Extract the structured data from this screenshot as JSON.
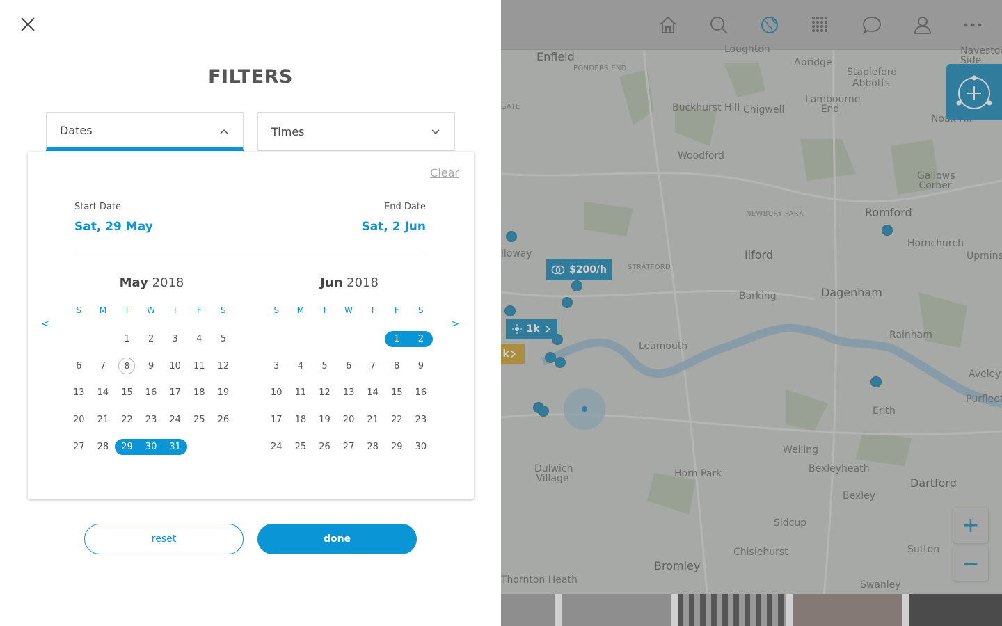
{
  "filters": {
    "title": "FILTERS",
    "dates_label": "Dates",
    "times_label": "Times",
    "clear_label": "Clear",
    "start_date_label": "Start Date",
    "start_date_value": "Sat, 29 May",
    "end_date_label": "End Date",
    "end_date_value": "Sat, 2 Jun",
    "prev_arrow": "<",
    "next_arrow": ">",
    "reset_label": "reset",
    "done_label": "done"
  },
  "calendar": {
    "weekdays": [
      "S",
      "M",
      "T",
      "W",
      "T",
      "F",
      "S"
    ],
    "months": [
      {
        "name": "May",
        "year": "2018",
        "offset": 2,
        "days": 31,
        "today": 8,
        "selected": [
          29,
          30,
          31
        ]
      },
      {
        "name": "Jun",
        "year": "2018",
        "offset": 5,
        "days": 30,
        "today": null,
        "selected": [
          1,
          2
        ]
      }
    ]
  },
  "map": {
    "price_tag": "$200/h",
    "count_tag": "1k",
    "count_tag2": "k",
    "zoom_in": "+",
    "zoom_out": "−",
    "places": [
      {
        "name": "Enfield"
      },
      {
        "name": "PONDERS END"
      },
      {
        "name": "Loughton"
      },
      {
        "name": "Abridge"
      },
      {
        "name": "Stapleford Abbotts"
      },
      {
        "name": "Navestock Side"
      },
      {
        "name": "GATE"
      },
      {
        "name": "Buckhurst Hill"
      },
      {
        "name": "Chigwell"
      },
      {
        "name": "Lambourne End"
      },
      {
        "name": "Noak Hill"
      },
      {
        "name": "Woodford"
      },
      {
        "name": "Gallows Corner"
      },
      {
        "name": "NEWBURY PARK"
      },
      {
        "name": "Romford"
      },
      {
        "name": "lloway"
      },
      {
        "name": "STRATFORD"
      },
      {
        "name": "Ilford"
      },
      {
        "name": "Hornchurch"
      },
      {
        "name": "Upminster"
      },
      {
        "name": "Barking"
      },
      {
        "name": "Dagenham"
      },
      {
        "name": "Rainham"
      },
      {
        "name": "Leamouth"
      },
      {
        "name": "Aveley"
      },
      {
        "name": "Purfleet"
      },
      {
        "name": "Erith"
      },
      {
        "name": "Welling"
      },
      {
        "name": "Dulwich Village"
      },
      {
        "name": "Horn Park"
      },
      {
        "name": "Bexleyheath"
      },
      {
        "name": "Dartford"
      },
      {
        "name": "Bexley"
      },
      {
        "name": "Sidcup"
      },
      {
        "name": "Chislehurst"
      },
      {
        "name": "Sutton"
      },
      {
        "name": "Bromley"
      },
      {
        "name": "Swanley"
      },
      {
        "name": "Thornton Heath"
      }
    ]
  },
  "colors": {
    "accent": "#0a96d6",
    "map_accent": "#0a7fb0",
    "pin_tag_gold": "#c69a23"
  },
  "icons": {
    "nav": [
      "home-icon",
      "search-icon",
      "globe-icon",
      "grid-icon",
      "chat-icon",
      "user-icon",
      "more-icon"
    ],
    "close": "close-icon",
    "chevron_up": "chevron-up-icon",
    "chevron_down": "chevron-down-icon"
  }
}
